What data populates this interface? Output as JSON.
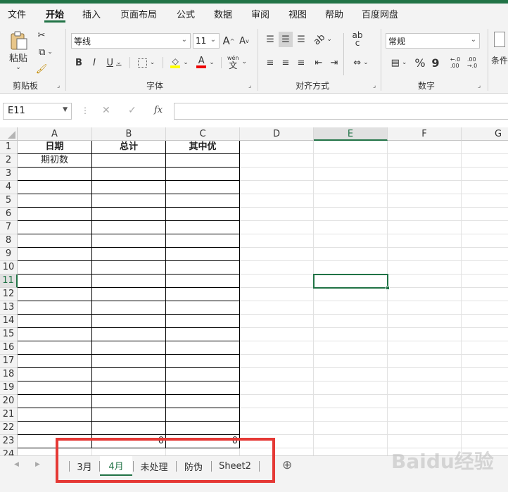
{
  "menu": {
    "items": [
      "文件",
      "开始",
      "插入",
      "页面布局",
      "公式",
      "数据",
      "审阅",
      "视图",
      "帮助",
      "百度网盘"
    ],
    "active": "开始"
  },
  "ribbon": {
    "clipboard": {
      "paste_label": "粘贴",
      "group_label": "剪贴板"
    },
    "font": {
      "font_name": "等线",
      "font_size": "11",
      "bold": "B",
      "italic": "I",
      "underline": "U",
      "grow": "A",
      "shrink": "A",
      "color_letter": "A",
      "wen": "wén",
      "wen_char": "文",
      "group_label": "字体"
    },
    "alignment": {
      "group_label": "对齐方式",
      "wrap_ab": "ab",
      "wrap_c": "c"
    },
    "number": {
      "format": "常规",
      "percent": "%",
      "comma": "9",
      "dec_inc": "←.0\n.00",
      "dec_dec": ".00\n→.0",
      "group_label": "数字"
    },
    "styles": {
      "cond_label": "条件"
    }
  },
  "formula_bar": {
    "name_box": "E11",
    "cancel": "✕",
    "enter": "✓",
    "fx": "fx",
    "formula": ""
  },
  "sheet": {
    "columns": [
      "A",
      "B",
      "C",
      "D",
      "E",
      "F",
      "G"
    ],
    "selected_column": "E",
    "selected_row": "11",
    "rows": [
      "1",
      "2",
      "3",
      "4",
      "5",
      "6",
      "7",
      "8",
      "9",
      "10",
      "11",
      "12",
      "13",
      "14",
      "15",
      "16",
      "17",
      "18",
      "19",
      "20",
      "21",
      "22",
      "23",
      "24"
    ],
    "cells": {
      "A1": "日期",
      "B1": "总计",
      "C1": "其中优",
      "A2": "期初数",
      "B23": "0",
      "C23": "0"
    }
  },
  "tabs": {
    "items": [
      "3月",
      "4月",
      "未处理",
      "防伪",
      "Sheet2"
    ],
    "active": "4月",
    "add": "⊕",
    "prev": "◀",
    "next": "▶"
  },
  "watermark": "Baidu经验",
  "colors": {
    "accent": "#217346",
    "highlight_box": "#e53935"
  }
}
